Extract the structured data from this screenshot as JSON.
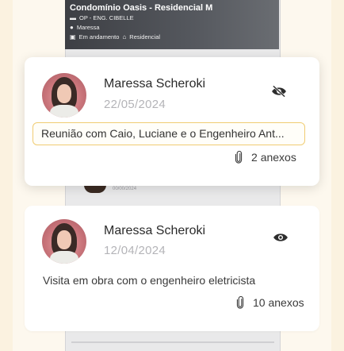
{
  "project_card": {
    "title": "Condomínio Oasis - Residencial M",
    "code": "OP - ENG. CIBELLE",
    "owner": "Maressa",
    "status": "Em andamento",
    "type": "Residencial",
    "peek_date": "00/00/2024"
  },
  "notes": [
    {
      "author": "Maressa Scheroki",
      "date": "22/05/2024",
      "visibility_icon": "eye-off-icon",
      "description": "Reunião com Caio, Luciane e o Engenheiro Ant...",
      "attachments_count": "2",
      "attachments_label": "anexos"
    },
    {
      "author": "Maressa Scheroki",
      "date": "12/04/2024",
      "visibility_icon": "eye-icon",
      "description": "Visita em obra com o engenheiro eletricista",
      "attachments_count": "10",
      "attachments_label": "anexos"
    }
  ],
  "colors": {
    "page_bg": "#fdf8ee",
    "card_bg": "#ffffff",
    "highlight_border": "#f0cc72",
    "muted_date": "#b4b4b8"
  }
}
